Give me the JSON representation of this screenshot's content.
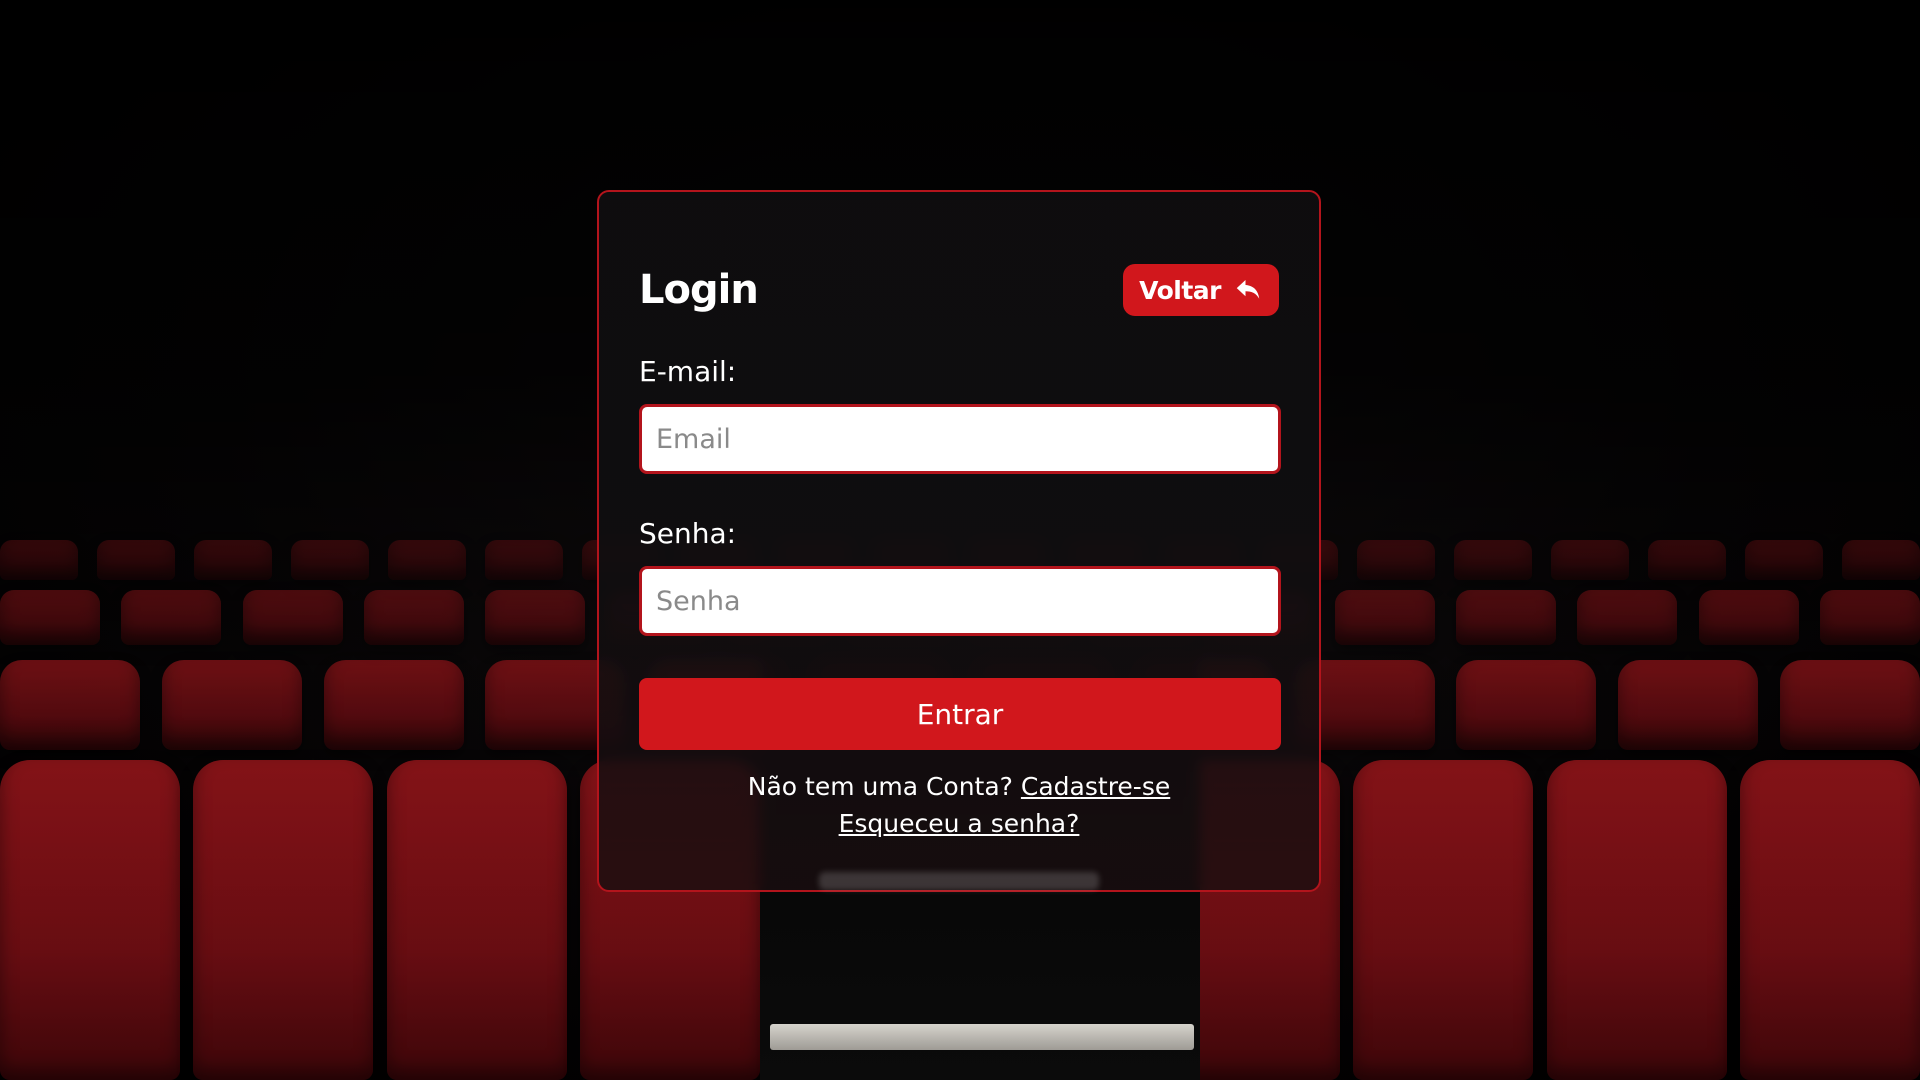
{
  "page": {
    "background_theme": "cinema seats"
  },
  "login": {
    "title": "Login",
    "back_button_label": "Voltar",
    "back_icon": "undo-arrow-icon",
    "email_label": "E-mail:",
    "email_placeholder": "Email",
    "email_value": "",
    "password_label": "Senha:",
    "password_placeholder": "Senha",
    "password_value": "",
    "submit_label": "Entrar",
    "signup_prompt": "Não tem uma Conta?",
    "signup_link": "Cadastre-se",
    "forgot_link": "Esqueceu a senha?"
  },
  "colors": {
    "accent": "#d1171c",
    "border": "#b3141c",
    "card_background": "#0e0d0f",
    "text": "#ffffff"
  }
}
